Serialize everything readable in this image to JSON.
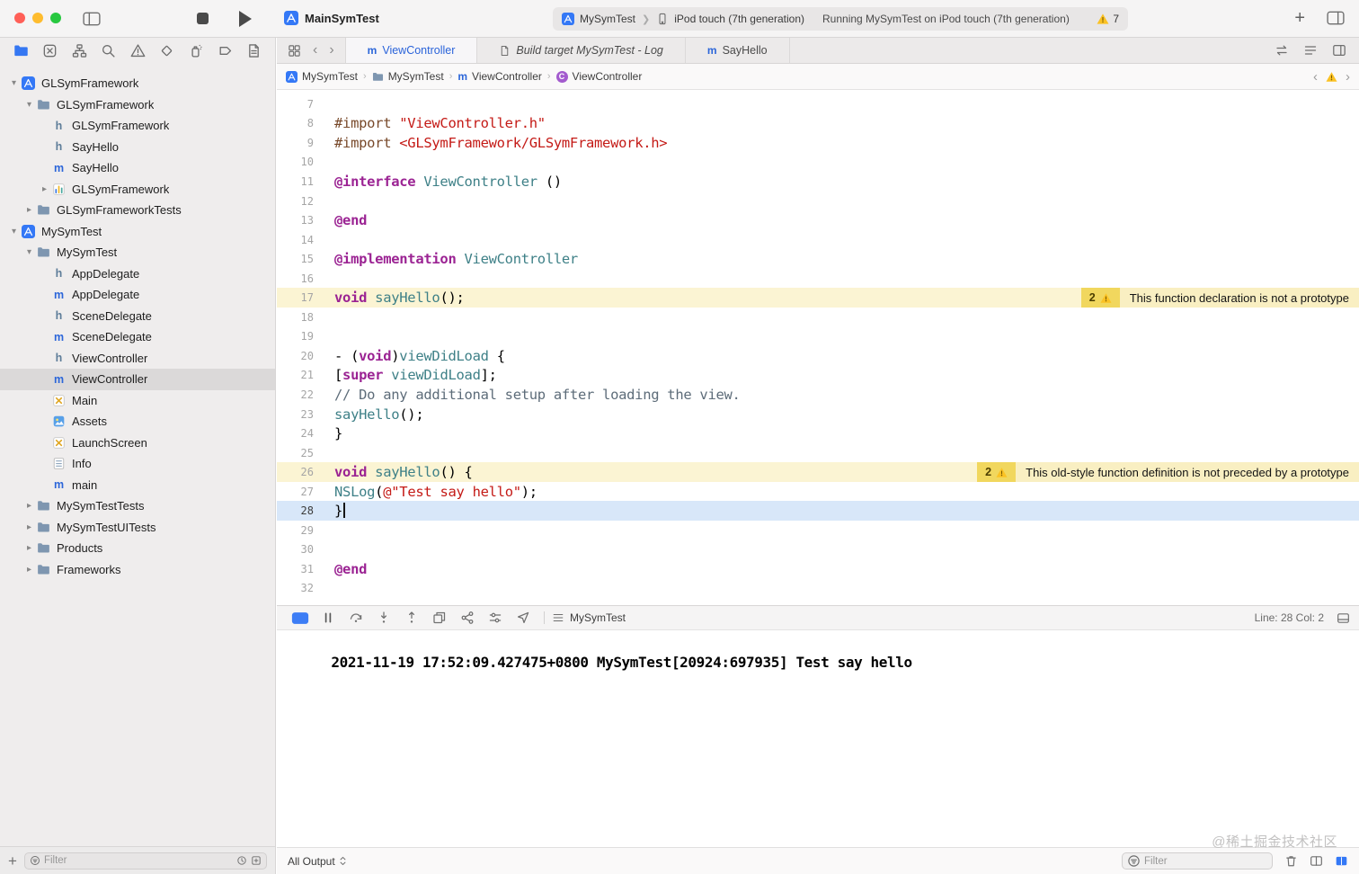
{
  "window_title": "MainSymTest",
  "toolbar": {
    "scheme_project": "MySymTest",
    "scheme_destination": "iPod touch (7th generation)",
    "status": "Running MySymTest on iPod touch (7th generation)",
    "issue_count": "7"
  },
  "navigator": {
    "icons": [
      "project",
      "source-control",
      "symbols",
      "find",
      "issues",
      "tests",
      "debug",
      "breakpoints",
      "reports"
    ],
    "selected_icon": 0,
    "filter_placeholder": "Filter",
    "tree": [
      {
        "label": "GLSymFramework",
        "type": "project",
        "depth": 0,
        "disclosure": "open"
      },
      {
        "label": "GLSymFramework",
        "type": "folder",
        "depth": 1,
        "disclosure": "open"
      },
      {
        "label": "GLSymFramework",
        "type": "h",
        "depth": 2
      },
      {
        "label": "SayHello",
        "type": "h",
        "depth": 2
      },
      {
        "label": "SayHello",
        "type": "m",
        "depth": 2
      },
      {
        "label": "GLSymFramework",
        "type": "framework",
        "depth": 2,
        "disclosure": "closed"
      },
      {
        "label": "GLSymFrameworkTests",
        "type": "folder",
        "depth": 1,
        "disclosure": "closed"
      },
      {
        "label": "MySymTest",
        "type": "project",
        "depth": 0,
        "disclosure": "open"
      },
      {
        "label": "MySymTest",
        "type": "folder",
        "depth": 1,
        "disclosure": "open"
      },
      {
        "label": "AppDelegate",
        "type": "h",
        "depth": 2
      },
      {
        "label": "AppDelegate",
        "type": "m",
        "depth": 2
      },
      {
        "label": "SceneDelegate",
        "type": "h",
        "depth": 2
      },
      {
        "label": "SceneDelegate",
        "type": "m",
        "depth": 2
      },
      {
        "label": "ViewController",
        "type": "h",
        "depth": 2
      },
      {
        "label": "ViewController",
        "type": "m",
        "depth": 2,
        "selected": true
      },
      {
        "label": "Main",
        "type": "storyboard",
        "depth": 2
      },
      {
        "label": "Assets",
        "type": "assets",
        "depth": 2
      },
      {
        "label": "LaunchScreen",
        "type": "storyboard",
        "depth": 2
      },
      {
        "label": "Info",
        "type": "plist",
        "depth": 2
      },
      {
        "label": "main",
        "type": "m",
        "depth": 2
      },
      {
        "label": "MySymTestTests",
        "type": "folder",
        "depth": 1,
        "disclosure": "closed"
      },
      {
        "label": "MySymTestUITests",
        "type": "folder",
        "depth": 1,
        "disclosure": "closed"
      },
      {
        "label": "Products",
        "type": "folder",
        "depth": 1,
        "disclosure": "closed"
      },
      {
        "label": "Frameworks",
        "type": "folder",
        "depth": 1,
        "disclosure": "closed"
      }
    ]
  },
  "tabs": {
    "items": [
      {
        "label": "ViewController",
        "icon": "m",
        "active": true
      },
      {
        "label": "Build target MySymTest - Log",
        "icon": "log",
        "italic": true
      },
      {
        "label": "SayHello",
        "icon": "m"
      }
    ]
  },
  "jumpbar": {
    "crumbs": [
      {
        "label": "MySymTest",
        "icon": "project"
      },
      {
        "label": "MySymTest",
        "icon": "folder"
      },
      {
        "label": "ViewController",
        "icon": "m"
      },
      {
        "label": "ViewController",
        "icon": "class"
      }
    ]
  },
  "code": {
    "issues": {
      "w1": {
        "count": "2",
        "message": "This function declaration is not a prototype"
      },
      "w2": {
        "count": "2",
        "message": "This old-style function definition is not preceded by a prototype"
      }
    },
    "lines": [
      {
        "n": 7,
        "t": []
      },
      {
        "n": 8,
        "t": [
          [
            "d",
            "#import "
          ],
          [
            "s",
            "\"ViewController.h\""
          ]
        ]
      },
      {
        "n": 9,
        "t": [
          [
            "d",
            "#import "
          ],
          [
            "s",
            "<GLSymFramework/GLSymFramework.h>"
          ]
        ]
      },
      {
        "n": 10,
        "t": []
      },
      {
        "n": 11,
        "t": [
          [
            "k",
            "@interface "
          ],
          [
            "c",
            "ViewController "
          ],
          [
            "p",
            "()"
          ]
        ]
      },
      {
        "n": 12,
        "t": []
      },
      {
        "n": 13,
        "t": [
          [
            "k",
            "@end"
          ]
        ]
      },
      {
        "n": 14,
        "t": []
      },
      {
        "n": 15,
        "t": [
          [
            "k",
            "@implementation "
          ],
          [
            "c",
            "ViewController"
          ]
        ]
      },
      {
        "n": 16,
        "t": []
      },
      {
        "n": 17,
        "t": [
          [
            "k",
            "void "
          ],
          [
            "c",
            "sayHello"
          ],
          [
            "p",
            "();"
          ]
        ],
        "w": "w1"
      },
      {
        "n": 18,
        "t": []
      },
      {
        "n": 19,
        "t": []
      },
      {
        "n": 20,
        "t": [
          [
            "p",
            "- ("
          ],
          [
            "k",
            "void"
          ],
          [
            "p",
            ")"
          ],
          [
            "c",
            "viewDidLoad"
          ],
          [
            "p",
            " {"
          ]
        ]
      },
      {
        "n": 21,
        "t": [
          [
            "p",
            "    ["
          ],
          [
            "k",
            "super"
          ],
          [
            "p",
            " "
          ],
          [
            "c",
            "viewDidLoad"
          ],
          [
            "p",
            "];"
          ]
        ]
      },
      {
        "n": 22,
        "t": [
          [
            "m",
            "    // Do any additional setup after loading the view."
          ]
        ]
      },
      {
        "n": 23,
        "t": [
          [
            "p",
            "    "
          ],
          [
            "c",
            "sayHello"
          ],
          [
            "p",
            "();"
          ]
        ]
      },
      {
        "n": 24,
        "t": [
          [
            "p",
            "}"
          ]
        ]
      },
      {
        "n": 25,
        "t": []
      },
      {
        "n": 26,
        "t": [
          [
            "k",
            "void "
          ],
          [
            "c",
            "sayHello"
          ],
          [
            "p",
            "() {"
          ]
        ],
        "w": "w2"
      },
      {
        "n": 27,
        "t": [
          [
            "p",
            "    "
          ],
          [
            "c",
            "NSLog"
          ],
          [
            "p",
            "("
          ],
          [
            "s",
            "@\"Test say hello\""
          ],
          [
            "p",
            ");"
          ]
        ]
      },
      {
        "n": 28,
        "t": [
          [
            "p",
            "}"
          ]
        ],
        "cur": true
      },
      {
        "n": 29,
        "t": []
      },
      {
        "n": 30,
        "t": []
      },
      {
        "n": 31,
        "t": [
          [
            "k",
            "@end"
          ]
        ]
      },
      {
        "n": 32,
        "t": []
      }
    ]
  },
  "debugbar": {
    "target": "MySymTest",
    "line_col": "Line: 28  Col: 2"
  },
  "console": {
    "output": "2021-11-19 17:52:09.427475+0800 MySymTest[20924:697935] Test say hello",
    "all_output": "All Output",
    "filter_placeholder": "Filter"
  },
  "watermark": "@稀土掘金技术社区"
}
